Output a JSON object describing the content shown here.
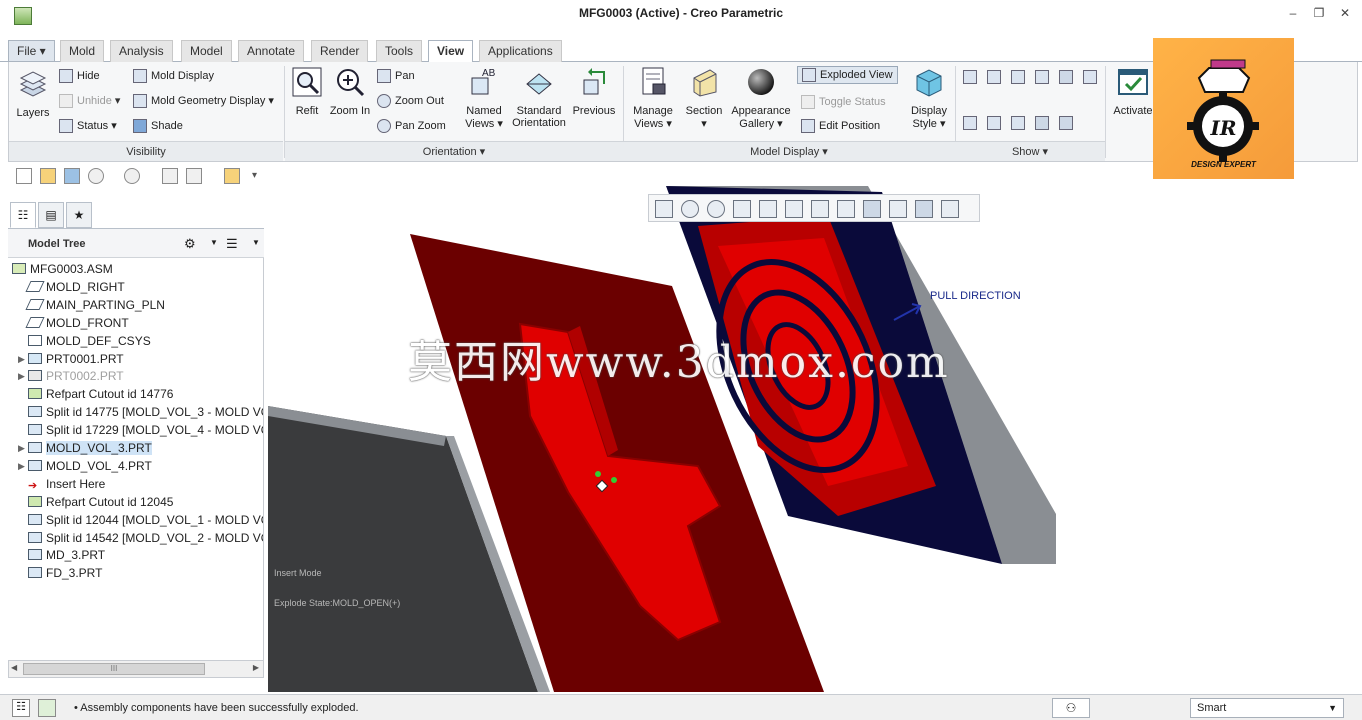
{
  "window": {
    "title": "MFG0003 (Active) - Creo Parametric",
    "minimize": "–",
    "restore": "❐",
    "close": "✕"
  },
  "ribbon_tabs": [
    "File ▾",
    "Mold",
    "Analysis",
    "Model",
    "Annotate",
    "Render",
    "Tools",
    "View",
    "Applications"
  ],
  "active_tab": "View",
  "ribbon": {
    "visibility": {
      "layers": "Layers",
      "hide": "Hide",
      "unhide": "Unhide",
      "status": "Status",
      "mold_display": "Mold Display",
      "mold_geometry_display": "Mold Geometry Display",
      "shade": "Shade",
      "group_label": "Visibility"
    },
    "orientation": {
      "refit": "Refit",
      "zoom_in": "Zoom In",
      "pan": "Pan",
      "zoom_out": "Zoom Out",
      "pan_zoom": "Pan Zoom",
      "named_views_1": "Named",
      "named_views_2": "Views ▾",
      "standard_orientation_1": "Standard",
      "standard_orientation_2": "Orientation",
      "previous": "Previous",
      "group_label": "Orientation ▾"
    },
    "model_display": {
      "manage_views_1": "Manage",
      "manage_views_2": "Views ▾",
      "section_1": "Section",
      "section_2": "▾",
      "appearance_gallery_1": "Appearance",
      "appearance_gallery_2": "Gallery ▾",
      "exploded_view": "Exploded View",
      "toggle_status": "Toggle Status",
      "edit_position": "Edit Position",
      "display_style_1": "Display",
      "display_style_2": "Style ▾",
      "group_label": "Model Display ▾"
    },
    "show": {
      "group_label": "Show ▾"
    },
    "activate": "Activate"
  },
  "model_tree": {
    "title": "Model Tree",
    "items": [
      {
        "label": "MFG0003.ASM",
        "expander": ""
      },
      {
        "label": "MOLD_RIGHT",
        "expander": ""
      },
      {
        "label": "MAIN_PARTING_PLN",
        "expander": ""
      },
      {
        "label": "MOLD_FRONT",
        "expander": ""
      },
      {
        "label": "MOLD_DEF_CSYS",
        "expander": ""
      },
      {
        "label": "PRT0001.PRT",
        "expander": "▶"
      },
      {
        "label": "PRT0002.PRT",
        "expander": "▶"
      },
      {
        "label": "Refpart Cutout id 14776",
        "expander": ""
      },
      {
        "label": "Split id 14775 [MOLD_VOL_3 - MOLD VO",
        "expander": ""
      },
      {
        "label": "Split id 17229 [MOLD_VOL_4 - MOLD VO",
        "expander": ""
      },
      {
        "label": "MOLD_VOL_3.PRT",
        "expander": "▶"
      },
      {
        "label": "MOLD_VOL_4.PRT",
        "expander": "▶"
      },
      {
        "label": "Insert Here",
        "expander": ""
      },
      {
        "label": "Refpart Cutout id 12045",
        "expander": ""
      },
      {
        "label": "Split id 12044 [MOLD_VOL_1 - MOLD VO",
        "expander": ""
      },
      {
        "label": "Split id 14542 [MOLD_VOL_2 - MOLD VO",
        "expander": ""
      },
      {
        "label": "MD_3.PRT",
        "expander": ""
      },
      {
        "label": "FD_3.PRT",
        "expander": ""
      }
    ],
    "scroll_grip": "III"
  },
  "viewport": {
    "pull_direction": "PULL DIRECTION",
    "insert_mode": "Insert Mode",
    "explode_state": "Explode State:MOLD_OPEN(+)",
    "watermark": "莫西网www.3dmox.com"
  },
  "logo": {
    "monogram": "IR",
    "tagline": "DESIGN EXPERT"
  },
  "status_bar": {
    "message": "• Assembly components have been successfully exploded.",
    "filter_value": "Smart"
  },
  "colors": {
    "mold_red": "#e00000",
    "plate_dark_red": "#6b0000",
    "cavity_navy": "#0a0a3a",
    "plate_grey": "#8a8e93",
    "logo_orange": "#f7a541"
  }
}
